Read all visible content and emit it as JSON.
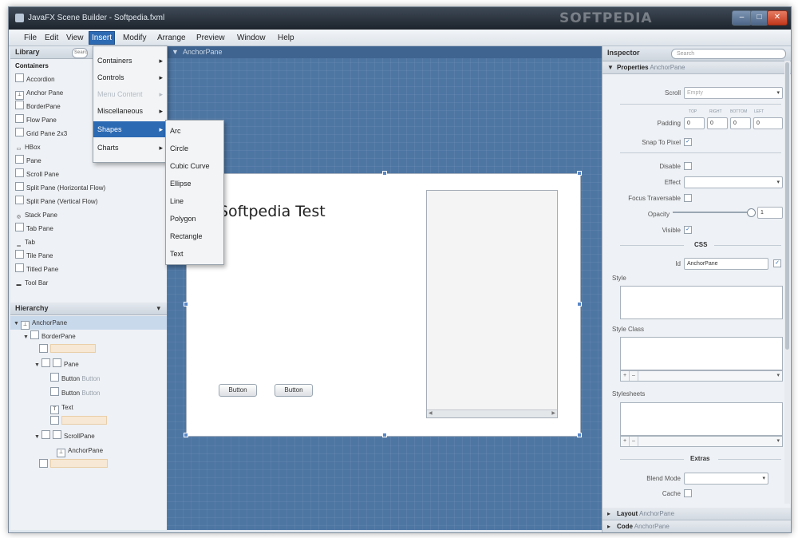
{
  "window": {
    "title": "JavaFX Scene Builder - Softpedia.fxml",
    "watermark": "SOFTPEDIA",
    "minimize": "–",
    "maximize": "□",
    "close": "✕"
  },
  "menubar": [
    "File",
    "Edit",
    "View",
    "Insert",
    "Modify",
    "Arrange",
    "Preview",
    "Window",
    "Help"
  ],
  "library": {
    "title": "Library",
    "search_placeholder": "Search",
    "items": [
      {
        "label": "Containers"
      },
      {
        "label": "Accordion"
      },
      {
        "label": "Anchor Pane"
      },
      {
        "label": "BorderPane"
      },
      {
        "label": "Flow Pane"
      },
      {
        "label": "Grid Pane 2x3"
      },
      {
        "label": "HBox"
      },
      {
        "label": "Pane"
      },
      {
        "label": "Scroll Pane"
      },
      {
        "label": "Split Pane (Horizontal Flow)"
      },
      {
        "label": "Split Pane (Vertical Flow)"
      },
      {
        "label": "Stack Pane"
      },
      {
        "label": "Tab Pane"
      },
      {
        "label": "Tab"
      },
      {
        "label": "Tile Pane"
      },
      {
        "label": "Titled Pane"
      },
      {
        "label": "Tool Bar"
      }
    ]
  },
  "hierarchy": {
    "title": "Hierarchy",
    "collapse": "▾",
    "rows": [
      {
        "arrow": "▼",
        "label": "AnchorPane"
      },
      {
        "arrow": "▼",
        "label": "BorderPane"
      },
      {
        "arrow": "",
        "label": "",
        "faded": true
      },
      {
        "arrow": "▼",
        "label": "Pane"
      },
      {
        "arrow": "",
        "label": "Button",
        "sub": "Button"
      },
      {
        "arrow": "",
        "label": "Button",
        "sub": "Button"
      },
      {
        "arrow": "",
        "label": "Text"
      },
      {
        "arrow": "",
        "label": "",
        "faded": true
      },
      {
        "arrow": "▼",
        "label": "ScrollPane"
      },
      {
        "arrow": "",
        "label": "AnchorPane"
      },
      {
        "arrow": "",
        "label": "",
        "faded": true
      }
    ]
  },
  "canvas": {
    "breadcrumb": "AnchorPane",
    "text": "Softpedia Test",
    "button1": "Button",
    "button2": "Button",
    "scroll_left": "◀",
    "scroll_right": "▶"
  },
  "insert_menu": {
    "items": [
      {
        "label": "Containers",
        "arrow": "▸"
      },
      {
        "label": "Controls",
        "arrow": "▸"
      },
      {
        "label": "Menu Content",
        "arrow": "▸",
        "disabled": true
      },
      {
        "label": "Miscellaneous",
        "arrow": "▸"
      },
      {
        "label": "Shapes",
        "arrow": "▸",
        "selected": true
      },
      {
        "label": "Charts",
        "arrow": "▸"
      }
    ]
  },
  "shapes_submenu": [
    "Arc",
    "Circle",
    "Cubic Curve",
    "Ellipse",
    "Line",
    "Polygon",
    "Rectangle",
    "Text"
  ],
  "inspector": {
    "title": "Inspector",
    "search_placeholder": "Search",
    "properties_label": "Properties",
    "properties_sub": "AnchorPane",
    "scroll_label": "Scroll",
    "scroll_value": "Empty",
    "padding_label": "Padding",
    "padding_headers": [
      "TOP",
      "RIGHT",
      "BOTTOM",
      "LEFT"
    ],
    "padding_values": [
      "0",
      "0",
      "0",
      "0"
    ],
    "snap_label": "Snap To Pixel",
    "disable_label": "Disable",
    "effect_label": "Effect",
    "focus_label": "Focus Traversable",
    "opacity_label": "Opacity",
    "opacity_value": "1",
    "visible_label": "Visible",
    "css_label": "CSS",
    "id_label": "Id",
    "id_value": "AnchorPane",
    "style_label": "Style",
    "styleclass_label": "Style Class",
    "stylesheets_label": "Stylesheets",
    "add": "+",
    "remove": "–",
    "expand": "▾",
    "extras_label": "Extras",
    "blend_label": "Blend Mode",
    "cache_label": "Cache",
    "layout_label": "Layout",
    "layout_sub": "AnchorPane",
    "code_label": "Code",
    "code_sub": "AnchorPane",
    "check": "✓",
    "caret": "▾"
  }
}
